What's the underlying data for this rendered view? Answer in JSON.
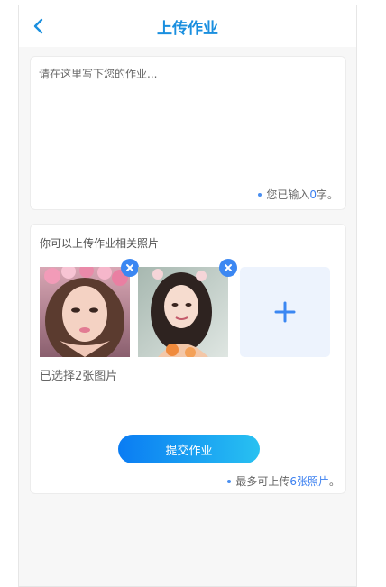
{
  "header": {
    "back_icon": "chevron-left-icon",
    "title": "上传作业",
    "accent_color": "#1a8fdf"
  },
  "text_card": {
    "placeholder": "请在这里写下您的作业...",
    "value": "",
    "count_prefix": "您已输入",
    "count_value": "0",
    "count_suffix": "字。"
  },
  "photo_card": {
    "label": "你可以上传作业相关照片",
    "photos": [
      {
        "alt": "photo 1",
        "delete_icon": "close-icon"
      },
      {
        "alt": "photo 2",
        "delete_icon": "close-icon"
      }
    ],
    "add_icon": "plus-icon",
    "selected_text": "已选择2张图片",
    "submit_label": "提交作业",
    "limit_prefix": "最多可上传",
    "limit_value": "6张照片",
    "limit_suffix": "。"
  },
  "colors": {
    "primary_blue": "#3b87f2",
    "button_gradient_start": "#0a7cf3",
    "button_gradient_end": "#28c1f1",
    "add_tile_bg": "#edf3fd"
  }
}
